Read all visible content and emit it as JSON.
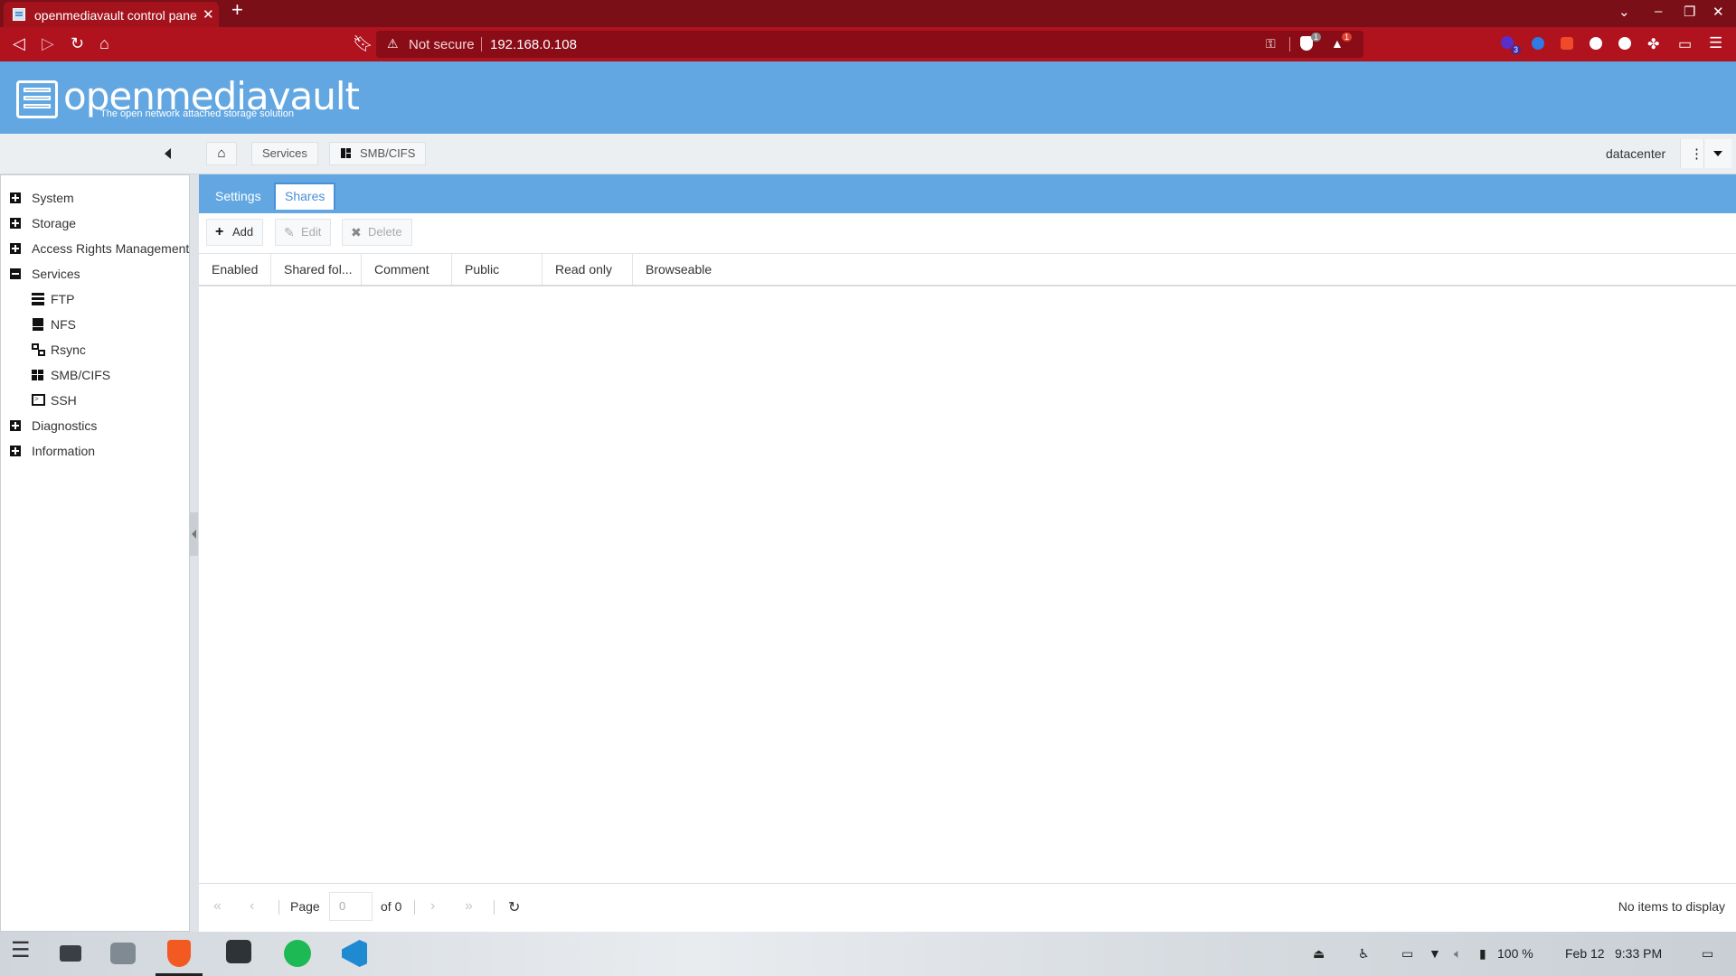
{
  "browser": {
    "tab_title": "openmediavault control panel - datacenter",
    "url_warning": "Not secure",
    "url": "192.168.0.108",
    "shield_count": "1",
    "alert_count": "1",
    "ext_badge": "3"
  },
  "header": {
    "logo_text": "openmediavault",
    "logo_subtitle": "The open network attached storage solution"
  },
  "breadcrumb": {
    "services": "Services",
    "smb": "SMB/CIFS",
    "user": "datacenter"
  },
  "sidebar": {
    "items": [
      {
        "label": "System",
        "state": "collapsed"
      },
      {
        "label": "Storage",
        "state": "collapsed"
      },
      {
        "label": "Access Rights Management",
        "state": "collapsed"
      },
      {
        "label": "Services",
        "state": "expanded"
      },
      {
        "label": "Diagnostics",
        "state": "collapsed"
      },
      {
        "label": "Information",
        "state": "collapsed"
      }
    ],
    "services_children": [
      {
        "label": "FTP",
        "icon": "ftp-icon"
      },
      {
        "label": "NFS",
        "icon": "nfs-icon"
      },
      {
        "label": "Rsync",
        "icon": "rsync-icon"
      },
      {
        "label": "SMB/CIFS",
        "icon": "windows-icon"
      },
      {
        "label": "SSH",
        "icon": "terminal-icon"
      }
    ]
  },
  "tabs": {
    "settings": "Settings",
    "shares": "Shares",
    "active": "Shares"
  },
  "toolbar": {
    "add": "Add",
    "edit": "Edit",
    "delete": "Delete"
  },
  "grid": {
    "columns": [
      "Enabled",
      "Shared fol...",
      "Comment",
      "Public",
      "Read only",
      "Browseable"
    ],
    "rows": []
  },
  "pager": {
    "page_label": "Page",
    "page_value": "0",
    "of_label": "of 0",
    "empty_text": "No items to display"
  },
  "taskbar": {
    "battery": "100 %",
    "date": "Feb 12",
    "time": "9:33 PM"
  },
  "colors": {
    "browser_frame": "#b0121e",
    "omv_blue": "#62a7e2",
    "active_tab": "#4a90d6"
  }
}
